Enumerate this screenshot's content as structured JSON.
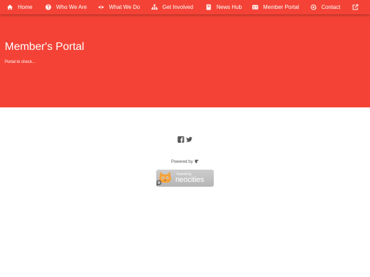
{
  "nav": {
    "home": "Home",
    "who": "Who We Are",
    "what": "What We Do",
    "involved": "Get Involved",
    "news": "News Hub",
    "member": "Member Portal",
    "contact": "Contact",
    "external_icon": "external-link-icon"
  },
  "hero": {
    "title": "Member's Portal",
    "text": "Portal to check..."
  },
  "footer": {
    "social_icons": [
      "facebook-icon",
      "twitter-icon"
    ],
    "powered_by": "Powered by",
    "badge_small": "hosted by",
    "badge_big": "neocities"
  },
  "colors": {
    "accent": "#f44336",
    "text_light": "#ffffff",
    "footer_text": "#555555"
  }
}
